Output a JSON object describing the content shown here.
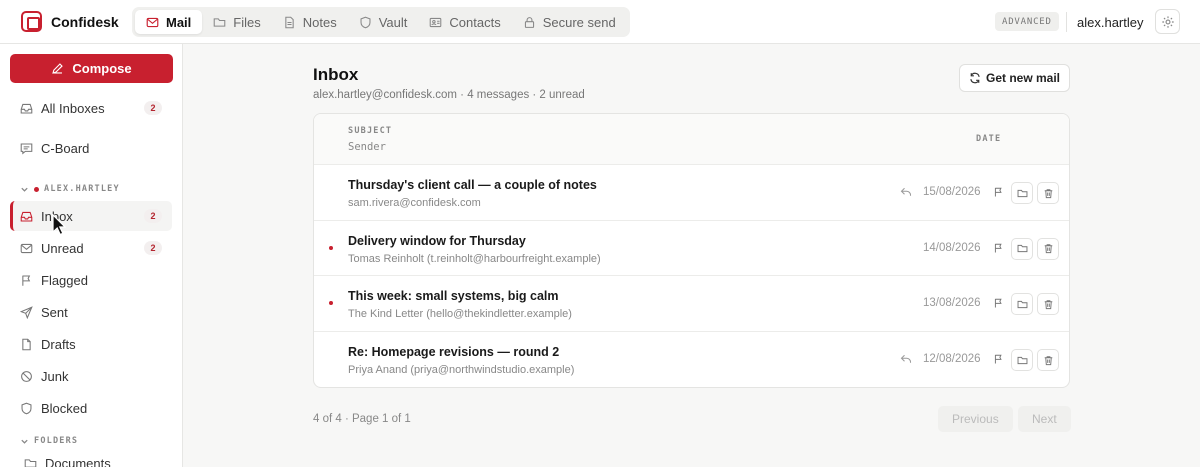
{
  "app": {
    "name": "Confidesk"
  },
  "nav": {
    "tabs": [
      {
        "label": "Mail",
        "icon": "mail-icon",
        "active": true
      },
      {
        "label": "Files",
        "icon": "folder-icon"
      },
      {
        "label": "Notes",
        "icon": "note-icon"
      },
      {
        "label": "Vault",
        "icon": "shield-icon"
      },
      {
        "label": "Contacts",
        "icon": "contacts-icon"
      },
      {
        "label": "Secure send",
        "icon": "lock-icon"
      }
    ]
  },
  "header": {
    "mode_badge": "ADVANCED",
    "user": "alex.hartley",
    "settings_icon": "gear-icon"
  },
  "sidebar": {
    "compose_label": "Compose",
    "top_items": [
      {
        "label": "All Inboxes",
        "count": "2",
        "icon": "inbox-icon"
      },
      {
        "label": "C-Board",
        "icon": "chat-icon"
      }
    ],
    "account_label": "ALEX.HARTLEY",
    "folders": [
      {
        "label": "Inbox",
        "count": "2",
        "icon": "inbox-icon",
        "active": true
      },
      {
        "label": "Unread",
        "count": "2",
        "icon": "mail-icon"
      },
      {
        "label": "Flagged",
        "icon": "flag-icon"
      },
      {
        "label": "Sent",
        "icon": "send-icon"
      },
      {
        "label": "Drafts",
        "icon": "file-icon"
      },
      {
        "label": "Junk",
        "icon": "ban-icon"
      },
      {
        "label": "Blocked",
        "icon": "shield-icon"
      }
    ],
    "folders_section_label": "FOLDERS",
    "custom_folders": [
      {
        "label": "Documents",
        "icon": "folder-icon"
      }
    ]
  },
  "main": {
    "title": "Inbox",
    "subtitle": "alex.hartley@confidesk.com · 4 messages · 2 unread",
    "get_mail_label": "Get new mail",
    "columns": {
      "subject": "SUBJECT",
      "sender": "Sender",
      "date": "DATE"
    },
    "messages": [
      {
        "subject": "Thursday's client call — a couple of notes",
        "sender": "sam.rivera@confidesk.com",
        "date": "15/08/2026",
        "unread": false,
        "replied": true
      },
      {
        "subject": "Delivery window for Thursday",
        "sender": "Tomas Reinholt (t.reinholt@harbourfreight.example)",
        "date": "14/08/2026",
        "unread": true,
        "replied": false
      },
      {
        "subject": "This week: small systems, big calm",
        "sender": "The Kind Letter (hello@thekindletter.example)",
        "date": "13/08/2026",
        "unread": true,
        "replied": false
      },
      {
        "subject": "Re: Homepage revisions — round 2",
        "sender": "Priya Anand (priya@northwindstudio.example)",
        "date": "12/08/2026",
        "unread": false,
        "replied": true
      }
    ],
    "pager": {
      "summary": "4 of 4 · Page 1 of 1",
      "prev": "Previous",
      "next": "Next"
    }
  },
  "colors": {
    "accent": "#c8202f",
    "background": "#f7f7f6"
  }
}
